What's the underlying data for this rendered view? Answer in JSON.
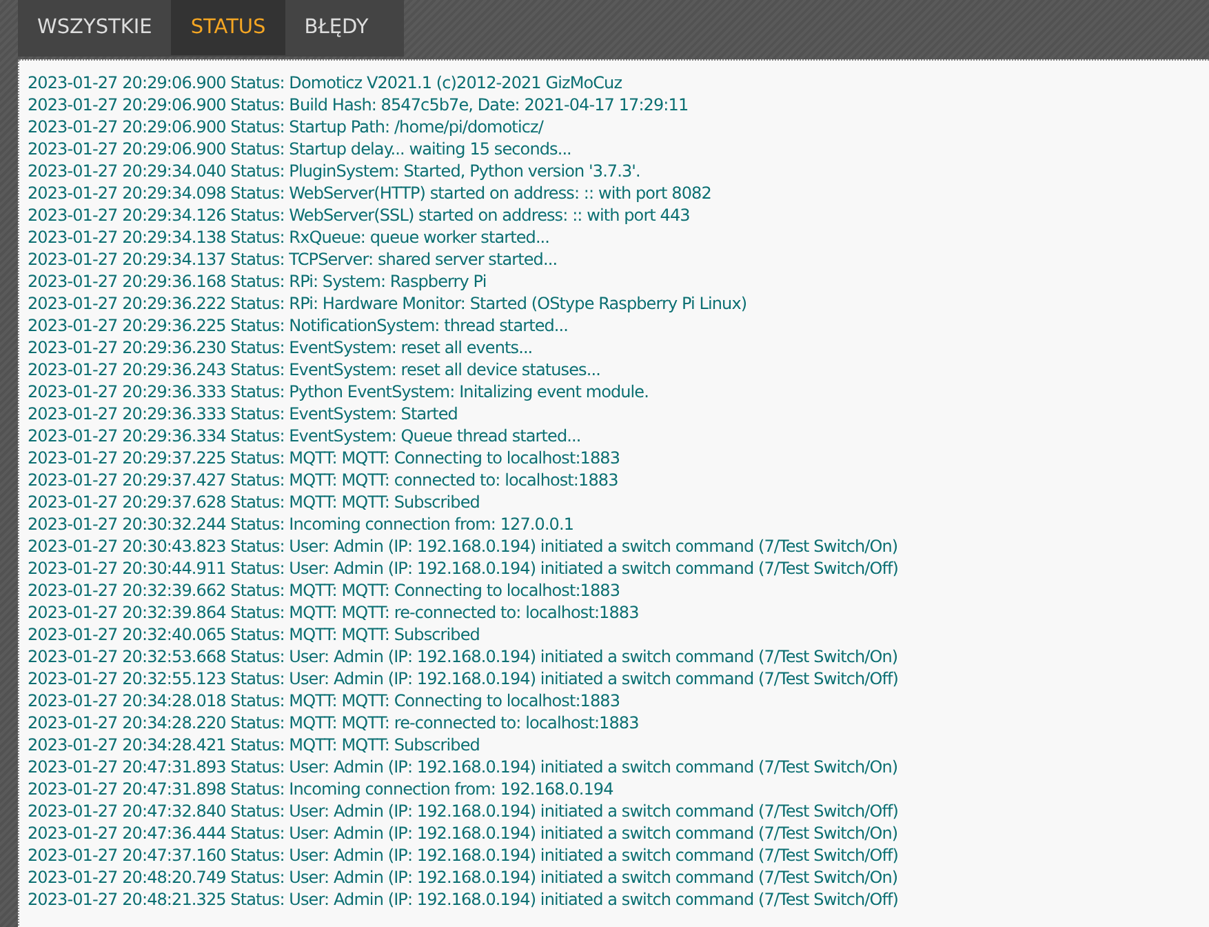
{
  "tabs": [
    {
      "label": "WSZYSTKIE",
      "selected": false
    },
    {
      "label": "STATUS",
      "selected": true
    },
    {
      "label": "BŁĘDY",
      "selected": false
    }
  ],
  "log": [
    "2023-01-27 20:29:06.900 Status: Domoticz V2021.1 (c)2012-2021 GizMoCuz",
    "2023-01-27 20:29:06.900 Status: Build Hash: 8547c5b7e, Date: 2021-04-17 17:29:11",
    "2023-01-27 20:29:06.900 Status: Startup Path: /home/pi/domoticz/",
    "2023-01-27 20:29:06.900 Status: Startup delay... waiting 15 seconds...",
    "2023-01-27 20:29:34.040 Status: PluginSystem: Started, Python version '3.7.3'.",
    "2023-01-27 20:29:34.098 Status: WebServer(HTTP) started on address: :: with port 8082",
    "2023-01-27 20:29:34.126 Status: WebServer(SSL) started on address: :: with port 443",
    "2023-01-27 20:29:34.138 Status: RxQueue: queue worker started...",
    "2023-01-27 20:29:34.137 Status: TCPServer: shared server started...",
    "2023-01-27 20:29:36.168 Status: RPi: System: Raspberry Pi",
    "2023-01-27 20:29:36.222 Status: RPi: Hardware Monitor: Started (OStype Raspberry Pi Linux)",
    "2023-01-27 20:29:36.225 Status: NotificationSystem: thread started...",
    "2023-01-27 20:29:36.230 Status: EventSystem: reset all events...",
    "2023-01-27 20:29:36.243 Status: EventSystem: reset all device statuses...",
    "2023-01-27 20:29:36.333 Status: Python EventSystem: Initalizing event module.",
    "2023-01-27 20:29:36.333 Status: EventSystem: Started",
    "2023-01-27 20:29:36.334 Status: EventSystem: Queue thread started...",
    "2023-01-27 20:29:37.225 Status: MQTT: MQTT: Connecting to localhost:1883",
    "2023-01-27 20:29:37.427 Status: MQTT: MQTT: connected to: localhost:1883",
    "2023-01-27 20:29:37.628 Status: MQTT: MQTT: Subscribed",
    "2023-01-27 20:30:32.244 Status: Incoming connection from: 127.0.0.1",
    "2023-01-27 20:30:43.823 Status: User: Admin (IP: 192.168.0.194) initiated a switch command (7/Test Switch/On)",
    "2023-01-27 20:30:44.911 Status: User: Admin (IP: 192.168.0.194) initiated a switch command (7/Test Switch/Off)",
    "2023-01-27 20:32:39.662 Status: MQTT: MQTT: Connecting to localhost:1883",
    "2023-01-27 20:32:39.864 Status: MQTT: MQTT: re-connected to: localhost:1883",
    "2023-01-27 20:32:40.065 Status: MQTT: MQTT: Subscribed",
    "2023-01-27 20:32:53.668 Status: User: Admin (IP: 192.168.0.194) initiated a switch command (7/Test Switch/On)",
    "2023-01-27 20:32:55.123 Status: User: Admin (IP: 192.168.0.194) initiated a switch command (7/Test Switch/Off)",
    "2023-01-27 20:34:28.018 Status: MQTT: MQTT: Connecting to localhost:1883",
    "2023-01-27 20:34:28.220 Status: MQTT: MQTT: re-connected to: localhost:1883",
    "2023-01-27 20:34:28.421 Status: MQTT: MQTT: Subscribed",
    "2023-01-27 20:47:31.893 Status: User: Admin (IP: 192.168.0.194) initiated a switch command (7/Test Switch/On)",
    "2023-01-27 20:47:31.898 Status: Incoming connection from: 192.168.0.194",
    "2023-01-27 20:47:32.840 Status: User: Admin (IP: 192.168.0.194) initiated a switch command (7/Test Switch/Off)",
    "2023-01-27 20:47:36.444 Status: User: Admin (IP: 192.168.0.194) initiated a switch command (7/Test Switch/On)",
    "2023-01-27 20:47:37.160 Status: User: Admin (IP: 192.168.0.194) initiated a switch command (7/Test Switch/Off)",
    "2023-01-27 20:48:20.749 Status: User: Admin (IP: 192.168.0.194) initiated a switch command (7/Test Switch/On)",
    "2023-01-27 20:48:21.325 Status: User: Admin (IP: 192.168.0.194) initiated a switch command (7/Test Switch/Off)"
  ]
}
